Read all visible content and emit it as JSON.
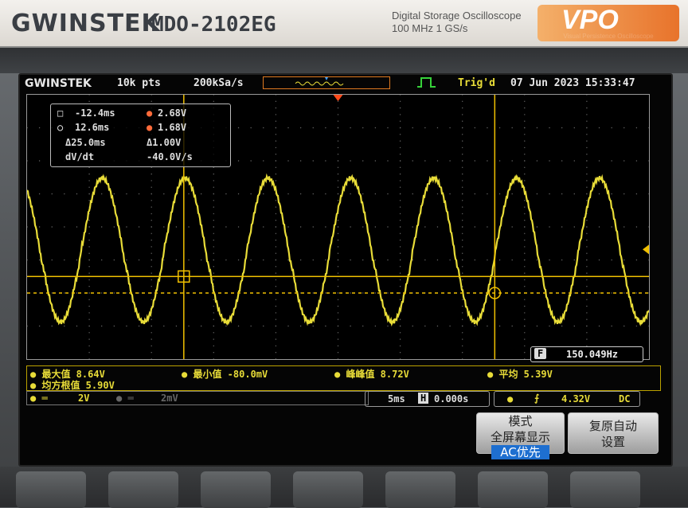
{
  "front_panel": {
    "brand": "GWINSTEK",
    "model": "MDO-2102EG",
    "description_line1": "Digital  Storage  Oscilloscope",
    "description_line2": "100 MHz   1 GS/s",
    "vpo_logo": "VPO",
    "vpo_sub": "Visual Persistence Oscilloscope"
  },
  "header": {
    "brand": "GWINSTEK",
    "record_length": "10k pts",
    "sample_rate": "200kSa/s",
    "trig_status": "Trig'd",
    "datetime": "07 Jun 2023  15:33:47"
  },
  "cursor_readout": {
    "t1_label": "-12.4ms",
    "v1_label": "2.68V",
    "t2_label": "12.6ms",
    "v2_label": "1.68V",
    "dt_label": "Δ25.0ms",
    "dv_label": "Δ1.00V",
    "dvdt_name": "dV/dt",
    "dvdt_value": "-40.0V/s"
  },
  "frequency": "150.049Hz",
  "measurements": {
    "max": "最大值 8.64V",
    "min": "最小值 -80.0mV",
    "pkpk": "峰峰值 8.72V",
    "mean": "平均 5.39V",
    "rms": "均方根值 5.90V"
  },
  "channel_bar": {
    "ch1": "2V",
    "ch2": "2mV"
  },
  "timebase": {
    "scale": "5ms",
    "delay": "0.000s"
  },
  "trigger_bar": {
    "level": "4.32V",
    "coupling": "DC"
  },
  "softkeys": {
    "left_line1": "模式",
    "left_line2": "全屏幕显示",
    "left_line3": "AC优先",
    "right_line1": "复原自动",
    "right_line2": "设置"
  },
  "colors": {
    "ch1": "#e8dc38",
    "trigger": "#f0c000",
    "highlight": "#1e6fd0",
    "accent": "#e8732b"
  },
  "waveform": {
    "period_ms": 6.664,
    "v_max": 8.64,
    "v_min": -0.08,
    "v_per_div": 2,
    "time_per_div_ms": 5
  }
}
